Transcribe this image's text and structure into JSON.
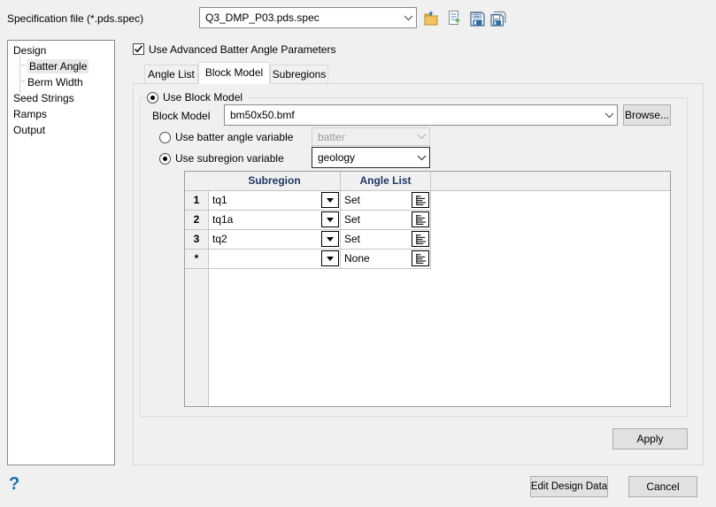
{
  "header": {
    "spec_label": "Specification file (*.pds.spec)",
    "spec_value": "Q3_DMP_P03.pds.spec"
  },
  "toolbar_icons": [
    "open-folder-icon",
    "new-spec-icon",
    "save-icon",
    "save-as-icon"
  ],
  "tree": {
    "items": [
      {
        "label": "Design",
        "level": 0,
        "selected": false
      },
      {
        "label": "Batter Angle",
        "level": 1,
        "selected": true
      },
      {
        "label": "Berm Width",
        "level": 1,
        "selected": false
      },
      {
        "label": "Seed Strings",
        "level": 0,
        "selected": false
      },
      {
        "label": "Ramps",
        "level": 0,
        "selected": false
      },
      {
        "label": "Output",
        "level": 0,
        "selected": false
      }
    ]
  },
  "main": {
    "advanced_checkbox_label": "Use Advanced Batter Angle Parameters",
    "advanced_checked": true,
    "tabs": [
      {
        "label": "Angle List",
        "active": false
      },
      {
        "label": "Block Model",
        "active": true
      },
      {
        "label": "Subregions",
        "active": false
      }
    ],
    "group": {
      "use_block_model_label": "Use Block Model",
      "use_block_model_selected": true,
      "block_model_label": "Block Model",
      "block_model_value": "bm50x50.bmf",
      "browse_label": "Browse...",
      "batter_radio_label": "Use batter angle variable",
      "batter_radio_selected": false,
      "batter_variable_value": "batter",
      "batter_variable_enabled": false,
      "subregion_radio_label": "Use subregion variable",
      "subregion_radio_selected": true,
      "subregion_variable_value": "geology",
      "table": {
        "columns": [
          "Subregion",
          "Angle List"
        ],
        "rows": [
          {
            "num": "1",
            "subregion": "tq1",
            "angle_list": "Set"
          },
          {
            "num": "2",
            "subregion": "tq1a",
            "angle_list": "Set"
          },
          {
            "num": "3",
            "subregion": "tq2",
            "angle_list": "Set"
          },
          {
            "num": "*",
            "subregion": "",
            "angle_list": "None"
          }
        ]
      }
    },
    "apply_label": "Apply"
  },
  "footer": {
    "help_label": "?",
    "edit_design_data_label": "Edit Design Data",
    "cancel_label": "Cancel"
  },
  "colors": {
    "dialog_bg": "#f0f0f0",
    "grid_header_text": "#1f3864",
    "help_blue": "#1a70a8",
    "folder_yellow": "#f2c45e",
    "new_plus_green": "#3da43d",
    "floppy_blue": "#2e6da4"
  }
}
